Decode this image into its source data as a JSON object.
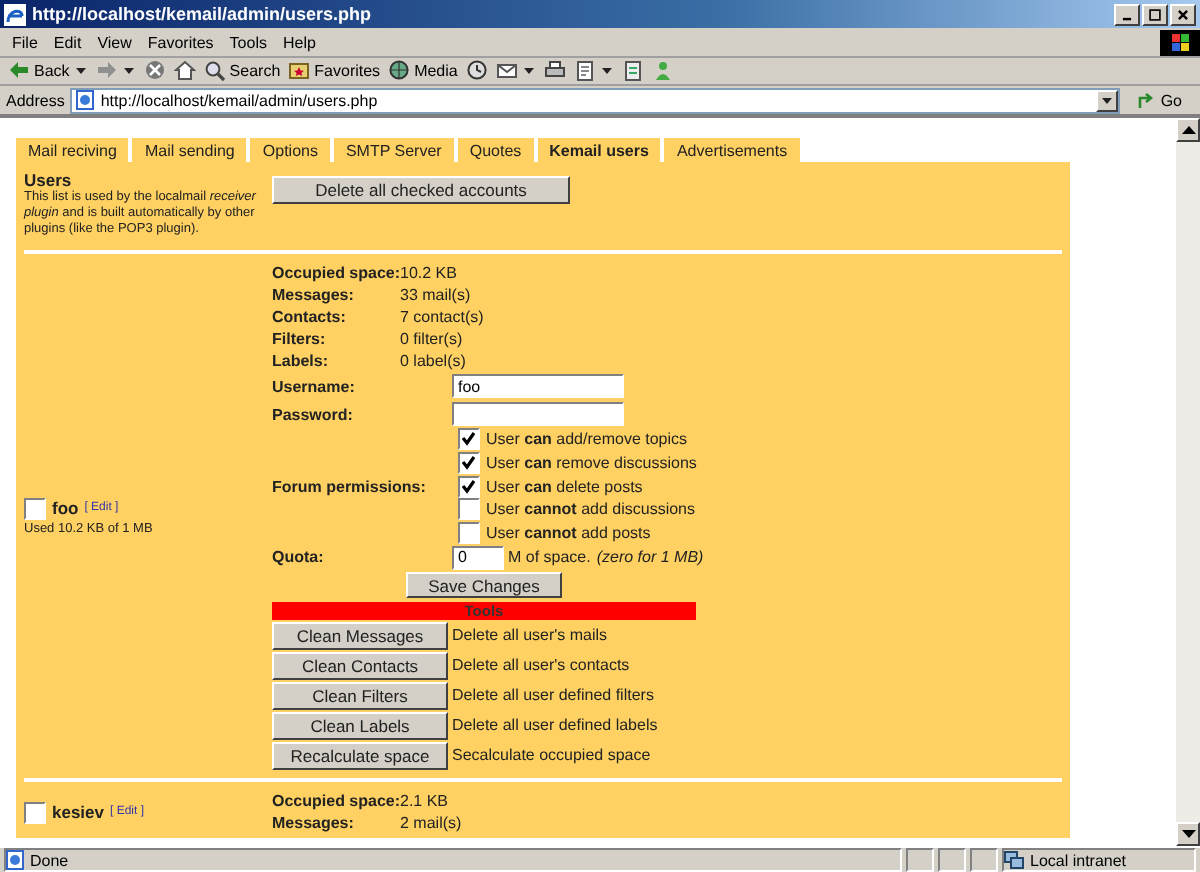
{
  "window": {
    "title": "http://localhost/kemail/admin/users.php"
  },
  "menu": [
    "File",
    "Edit",
    "View",
    "Favorites",
    "Tools",
    "Help"
  ],
  "toolbar": [
    {
      "kind": "labeled",
      "label": "Back"
    },
    {
      "kind": "icon"
    },
    {
      "kind": "icon"
    },
    {
      "kind": "icon"
    },
    {
      "kind": "labeled",
      "label": "Search"
    },
    {
      "kind": "labeled",
      "label": "Favorites"
    },
    {
      "kind": "labeled",
      "label": "Media"
    },
    {
      "kind": "icon"
    },
    {
      "kind": "icon"
    },
    {
      "kind": "icon"
    },
    {
      "kind": "icon"
    },
    {
      "kind": "icon"
    },
    {
      "kind": "icon"
    }
  ],
  "address": {
    "label": "Address",
    "url": "http://localhost/kemail/admin/users.php",
    "go": "Go"
  },
  "tabs": [
    {
      "label": "Mail reciving",
      "selected": false
    },
    {
      "label": "Mail sending",
      "selected": false
    },
    {
      "label": "Options",
      "selected": false
    },
    {
      "label": "SMTP Server",
      "selected": false
    },
    {
      "label": "Quotes",
      "selected": false
    },
    {
      "label": "Kemail users",
      "selected": true
    },
    {
      "label": "Advertisements",
      "selected": false
    }
  ],
  "users_panel": {
    "heading": "Users",
    "description": "This list is used by the localmail *receiver plugin* and is built automatically by other plugins (like the POP3 plugin).",
    "delete_button": "Delete all checked accounts"
  },
  "users": [
    {
      "name": "foo",
      "edit": "[ Edit ]",
      "checked": false,
      "usage": "Used 10.2 KB of 1 MB",
      "stats": [
        {
          "label": "Occupied space:",
          "value": "10.2 KB"
        },
        {
          "label": "Messages:",
          "value": "33 mail(s)"
        },
        {
          "label": "Contacts:",
          "value": "7 contact(s)"
        },
        {
          "label": "Filters:",
          "value": "0 filter(s)"
        },
        {
          "label": "Labels:",
          "value": "0 label(s)"
        }
      ],
      "username_label": "Username:",
      "username": "foo",
      "password_label": "Password:",
      "permissions_label": "Forum permissions:",
      "permissions": [
        {
          "text": "User **can** add/remove topics",
          "checked": true
        },
        {
          "text": "User **can** remove discussions",
          "checked": true
        },
        {
          "text": "User **can** delete posts",
          "checked": true
        },
        {
          "text": "User **cannot** add discussions",
          "checked": false
        },
        {
          "text": "User **cannot** add posts",
          "checked": false
        }
      ],
      "quota_label": "Quota:",
      "quota": "0",
      "quota_unit": "M of space.",
      "quota_hint": "(zero for 1 MB)",
      "save_button": "Save Changes",
      "tools_title": "Tools",
      "tools": [
        {
          "button": "Clean Messages",
          "description": "Delete all user's mails"
        },
        {
          "button": "Clean Contacts",
          "description": "Delete all user's contacts"
        },
        {
          "button": "Clean Filters",
          "description": "Delete all user defined filters"
        },
        {
          "button": "Clean Labels",
          "description": "Delete all user defined labels"
        },
        {
          "button": "Recalculate space",
          "description": "Secalculate occupied space"
        }
      ]
    },
    {
      "name": "kesiev",
      "edit": "[ Edit ]",
      "checked": false,
      "stats": [
        {
          "label": "Occupied space:",
          "value": "2.1 KB"
        },
        {
          "label": "Messages:",
          "value": "2 mail(s)"
        }
      ]
    }
  ],
  "status_bar": {
    "text": "Done",
    "zone": "Local intranet"
  }
}
